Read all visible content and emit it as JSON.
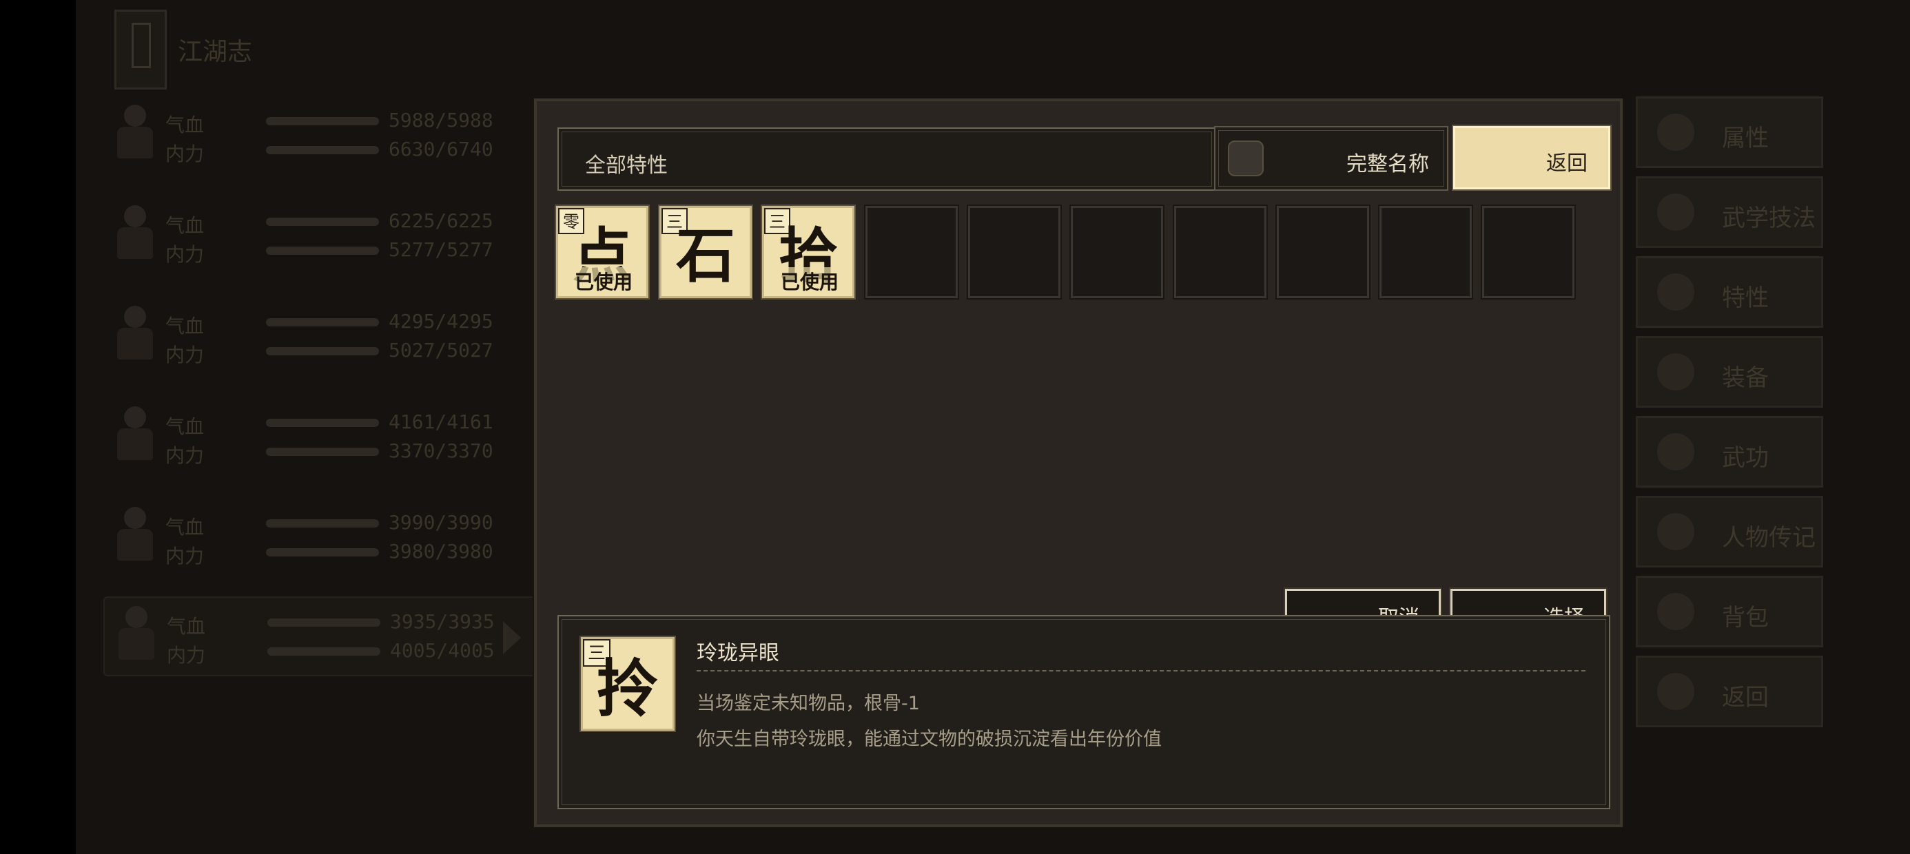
{
  "background": {
    "title": "江湖志",
    "party": [
      {
        "hp_label": "气血",
        "hp": "5988/5988",
        "mp_label": "内力",
        "mp": "6630/6740"
      },
      {
        "hp_label": "气血",
        "hp": "6225/6225",
        "mp_label": "内力",
        "mp": "5277/5277"
      },
      {
        "hp_label": "气血",
        "hp": "4295/4295",
        "mp_label": "内力",
        "mp": "5027/5027"
      },
      {
        "hp_label": "气血",
        "hp": "4161/4161",
        "mp_label": "内力",
        "mp": "3370/3370"
      },
      {
        "hp_label": "气血",
        "hp": "3990/3990",
        "mp_label": "内力",
        "mp": "3980/3980"
      },
      {
        "hp_label": "气血",
        "hp": "3935/3935",
        "mp_label": "内力",
        "mp": "4005/4005"
      }
    ],
    "menu": [
      "属性",
      "武学技法",
      "特性",
      "装备",
      "武功",
      "人物传记",
      "背包",
      "返回"
    ]
  },
  "dialog": {
    "filter_label": "全部特性",
    "full_name_label": "完整名称",
    "back_label": "返回",
    "traits": [
      {
        "rank": "零",
        "glyph": "点",
        "used": "已使用"
      },
      {
        "rank": "三",
        "glyph": "石",
        "used": ""
      },
      {
        "rank": "三",
        "glyph": "拾",
        "used": "已使用"
      }
    ],
    "empty_slots": 7,
    "cancel_label": "取消",
    "select_label": "选择",
    "detail": {
      "rank": "三",
      "glyph": "拎",
      "name": "玲珑异眼",
      "effect": "当场鉴定未知物品，根骨-1",
      "description": "你天生自带玲珑眼，能通过文物的破损沉淀看出年份价值"
    }
  }
}
